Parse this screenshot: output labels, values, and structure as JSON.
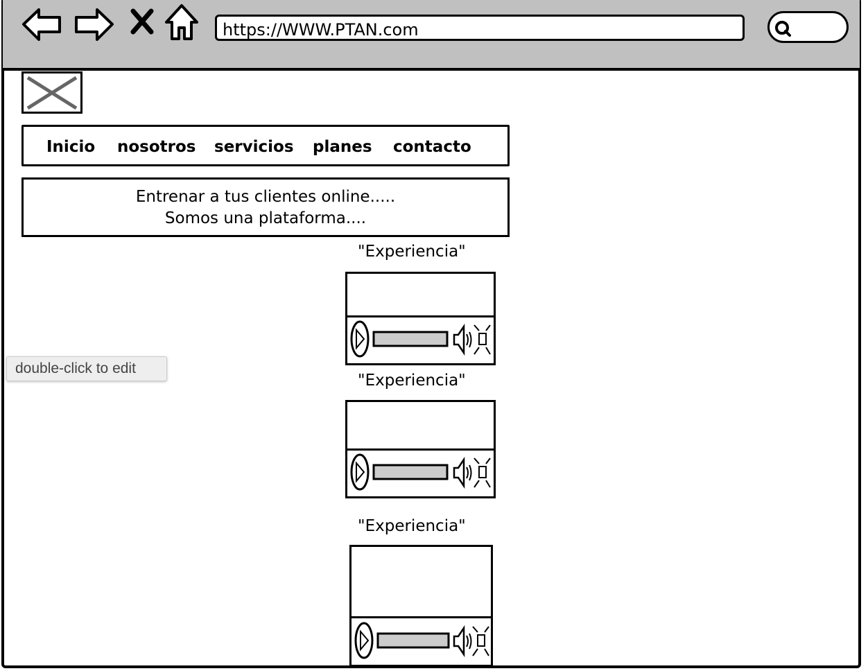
{
  "browser": {
    "url": "https://WWW.PTAN.com",
    "icons": [
      "back-arrow-icon",
      "forward-arrow-icon",
      "close-x-icon",
      "home-icon",
      "search-icon"
    ]
  },
  "nav": {
    "items": [
      "Inicio",
      "nosotros",
      "servicios",
      "planes",
      "contacto"
    ]
  },
  "hero": {
    "line1": "Entrenar a tus clientes online.....",
    "line2": "Somos una plataforma...."
  },
  "experiences": [
    {
      "title": "\"Experiencia\""
    },
    {
      "title": "\"Experiencia\""
    },
    {
      "title": "\"Experiencia\""
    }
  ],
  "tooltip": "double-click to edit"
}
